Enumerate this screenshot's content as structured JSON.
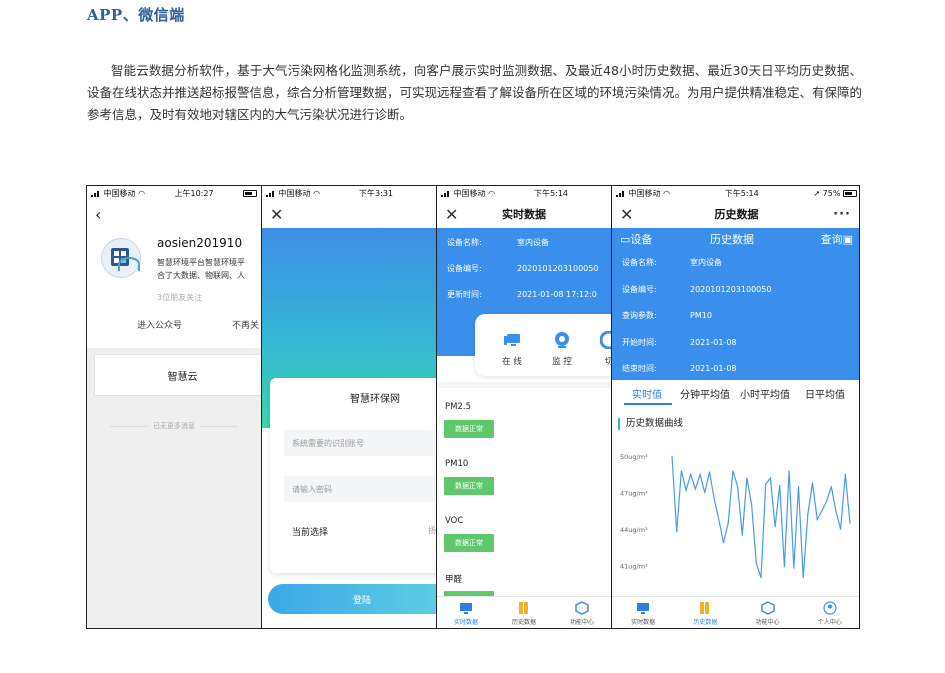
{
  "heading": "APP、微信端",
  "paragraph": "智能云数据分析软件，基于大气污染网格化监测系统，向客户展示实时监测数据、及最近48小时历史数据、最近30天日平均历史数据、设备在线状态并推送超标报警信息，综合分析管理数据，可实现远程查看了解设备所在区域的环境污染情况。为用户提供精准稳定、有保障的参考信息，及时有效地对辖区内的大气污染状况进行诊断。",
  "phone1": {
    "status": {
      "carrier": "中国移动",
      "time": "上午10:27"
    },
    "account_name": "aosien201910",
    "description_lines": [
      "智慧环境平台智慧环境平",
      "合了大数据、物联网、人"
    ],
    "followers": "3位朋友关注",
    "enter_label": "进入公众号",
    "unfollow_label": "不再关",
    "card_title": "智慧云",
    "no_more": "已无更多消息"
  },
  "phone2": {
    "status": {
      "carrier": "中国移动",
      "time": "下午3:31"
    },
    "login_title": "智慧环保网",
    "account_placeholder": "系统需要的识别账号",
    "password_placeholder": "请输入密码",
    "select_label": "当前选择",
    "select_value": "扬",
    "login_button": "登陆"
  },
  "phone3": {
    "status": {
      "carrier": "中国移动",
      "time": "下午5:14"
    },
    "title": "实时数据",
    "info": [
      {
        "key": "设备名称:",
        "value": "室内设备"
      },
      {
        "key": "设备编号:",
        "value": "2020101203100050"
      },
      {
        "key": "更新时间:",
        "value": "2021-01-08 17:12:0"
      }
    ],
    "quick": [
      {
        "icon": "monitor-online-icon",
        "label": "在 线"
      },
      {
        "icon": "camera-icon",
        "label": "监 控"
      },
      {
        "icon": "switch-icon",
        "label": "切"
      }
    ],
    "params": [
      {
        "name": "PM2.5",
        "status": "数据正常"
      },
      {
        "name": "PM10",
        "status": "数据正常"
      },
      {
        "name": "VOC",
        "status": "数据正常"
      },
      {
        "name": "甲醛",
        "status": ""
      }
    ],
    "tabs": [
      "实时数据",
      "历史数据",
      "功能中心"
    ]
  },
  "phone4": {
    "status": {
      "carrier": "中国移动",
      "time": "下午5:14",
      "battery": "75%"
    },
    "title": "历史数据",
    "more": "···",
    "header": {
      "device": "设备",
      "history": "历史数据",
      "query": "查询"
    },
    "info": [
      {
        "key": "设备名称:",
        "value": "室内设备"
      },
      {
        "key": "设备编号:",
        "value": "2020101203100050"
      },
      {
        "key": "查询参数:",
        "value": "PM10"
      },
      {
        "key": "开始时间:",
        "value": "2021-01-08"
      },
      {
        "key": "结束时间:",
        "value": "2021-01-08"
      }
    ],
    "tabs": [
      "实时值",
      "分钟平均值",
      "小时平均值",
      "日平均值"
    ],
    "section_title": "历史数据曲线",
    "bottom_tabs": [
      "实时数据",
      "历史数据",
      "功能中心",
      "个人中心"
    ]
  },
  "chart_data": {
    "type": "line",
    "title": "",
    "xlabel": "",
    "ylabel": "",
    "ytick_labels": [
      "50ug/m³",
      "47ug/m³",
      "44ug/m³",
      "41ug/m³"
    ],
    "yticks": [
      50,
      47,
      44,
      41
    ],
    "ylim": [
      39,
      51
    ],
    "color": "#4a9be6",
    "series": [
      {
        "values": [
          50,
          43.8,
          48.8,
          47.2,
          48.5,
          47.3,
          48.5,
          47,
          48.7,
          46.5,
          44.8,
          42.9,
          44.5,
          48.8,
          47.5,
          43.5,
          48.2,
          46,
          41.2,
          40,
          47.7,
          48.2,
          44.2,
          47.6,
          40.9,
          48.8,
          40.8,
          47.5,
          40,
          45.2,
          47.8,
          44.8,
          45.5,
          46.3,
          47.5,
          45.5,
          44,
          48.5,
          44.5
        ]
      }
    ]
  }
}
